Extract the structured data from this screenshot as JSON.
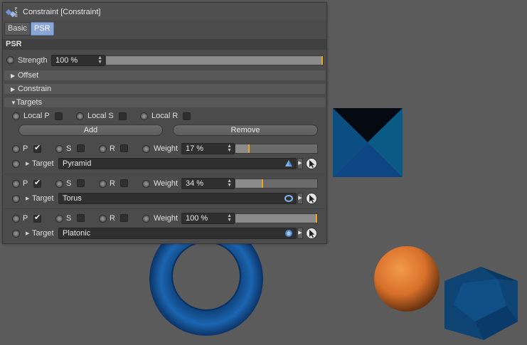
{
  "viewport": {
    "background": "#5b5b5b",
    "objects": [
      "pyramid",
      "torus",
      "sphere",
      "platonic"
    ]
  },
  "panel": {
    "title": "Constraint [Constraint]",
    "tabs": [
      {
        "label": "Basic",
        "active": false
      },
      {
        "label": "PSR",
        "active": true
      }
    ],
    "section_title": "PSR",
    "strength": {
      "label": "Strength",
      "value": "100 %",
      "fraction": 1.0
    },
    "groups": {
      "offset": "Offset",
      "constrain": "Constrain",
      "targets": "Targets"
    },
    "local": {
      "p": "Local P",
      "s": "Local S",
      "r": "Local R"
    },
    "add_label": "Add",
    "remove_label": "Remove",
    "targets": [
      {
        "p": "P",
        "s": "S",
        "r": "R",
        "p_checked": true,
        "weight_label": "Weight",
        "weight": "17 %",
        "fraction": 0.17,
        "target_label": "Target",
        "target": "Pyramid",
        "icon": "pyramid-icon"
      },
      {
        "p": "P",
        "s": "S",
        "r": "R",
        "p_checked": true,
        "weight_label": "Weight",
        "weight": "34 %",
        "fraction": 0.34,
        "target_label": "Target",
        "target": "Torus",
        "icon": "torus-icon"
      },
      {
        "p": "P",
        "s": "S",
        "r": "R",
        "p_checked": true,
        "weight_label": "Weight",
        "weight": "100 %",
        "fraction": 1.0,
        "target_label": "Target",
        "target": "Platonic",
        "icon": "platonic-icon"
      }
    ]
  },
  "colors": {
    "accent": "#e8a422",
    "tab_active": "#8aa6d6"
  }
}
